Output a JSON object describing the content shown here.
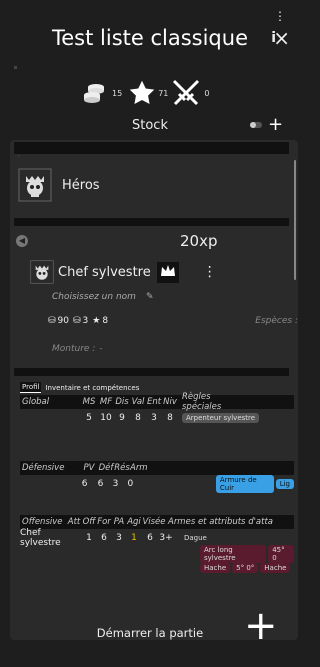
{
  "header": {
    "title": "Test liste classique",
    "info_label": "i",
    "close_label": "×"
  },
  "stats": {
    "coins": "15",
    "stars": "71",
    "swords": "0"
  },
  "stock": {
    "label": "Stock"
  },
  "heroes": {
    "label": "Héros"
  },
  "xp": {
    "label": "20xp"
  },
  "unit": {
    "name": "Chef sylvestre",
    "choose_name": "Choisissez un nom",
    "cost_a": "90",
    "cost_b": "3",
    "cost_c": "8",
    "species_label": "Espèces :",
    "mount_label": "Monture :",
    "mount_value": "-"
  },
  "tabs": [
    "Profil",
    "Inventaire et compétences"
  ],
  "profile": {
    "headers": [
      "Global",
      "MS",
      "MF",
      "Dis",
      "Val",
      "Ent",
      "Niv",
      "Règles spéciales"
    ],
    "values": [
      "5",
      "10",
      "9",
      "8",
      "3",
      "8"
    ],
    "special_rule": "Arpenteur sylvestre"
  },
  "defense": {
    "headers": [
      "Défensive",
      "PV",
      "Déf",
      "Rés",
      "Arm"
    ],
    "values": [
      "6",
      "6",
      "3",
      "0"
    ],
    "tags": [
      "Armure de Cuir",
      "Lig"
    ]
  },
  "offense": {
    "headers": [
      "Offensive",
      "Att",
      "Off",
      "For",
      "PA",
      "Agi",
      "Visée",
      "Armes et attributs d'atta"
    ],
    "row_name": "Chef sylvestre",
    "values": [
      "1",
      "6",
      "3",
      "1",
      "6",
      "3+"
    ],
    "weapons": [
      "Dague",
      "Arc long sylvestre",
      "45° 0",
      "Hache",
      "5° 0°",
      "Hache"
    ]
  },
  "footer": {
    "start_label": "Démarrer la partie",
    "add_label": "+"
  },
  "colors": {
    "accent_blue": "#3aa0e6",
    "maroon": "#5a1b2e",
    "yellow": "#e5c200"
  }
}
